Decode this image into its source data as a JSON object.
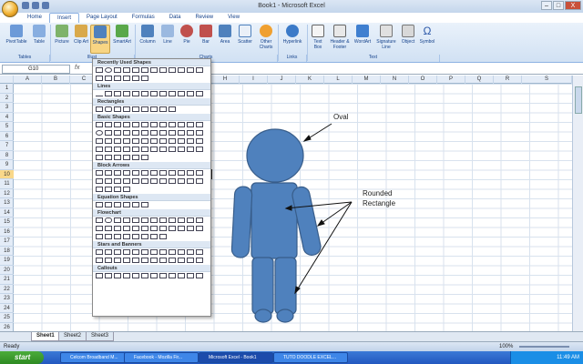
{
  "window": {
    "title": "Book1 - Microsoft Excel",
    "min": "–",
    "max": "□",
    "close": "X"
  },
  "tabs": [
    "Home",
    "Insert",
    "Page Layout",
    "Formulas",
    "Data",
    "Review",
    "View"
  ],
  "ribbon": {
    "buttons": [
      "PivotTable",
      "Table",
      "Picture",
      "Clip Art",
      "Shapes",
      "SmartArt",
      "Column",
      "Line",
      "Pie",
      "Bar",
      "Area",
      "Scatter",
      "Other Charts",
      "Hyperlink",
      "Text Box",
      "Header & Footer",
      "WordArt",
      "Signature Line",
      "Object",
      "Symbol"
    ],
    "groups": [
      "Tables",
      "Illust",
      "Charts",
      "Links",
      "Text"
    ]
  },
  "formula_bar": {
    "name_box": "G10",
    "fx": "fx",
    "value": ""
  },
  "columns": [
    "A",
    "B",
    "C",
    "D",
    "E",
    "F",
    "G",
    "H",
    "I",
    "J",
    "K",
    "L",
    "M",
    "N",
    "O",
    "P",
    "Q",
    "R",
    "S"
  ],
  "rows": [
    "1",
    "2",
    "3",
    "4",
    "5",
    "6",
    "7",
    "8",
    "9",
    "10",
    "11",
    "12",
    "13",
    "14",
    "15",
    "16",
    "17",
    "18",
    "19",
    "20",
    "21",
    "22",
    "23",
    "24",
    "25",
    "26"
  ],
  "shapes_menu": {
    "sections": [
      "Recently Used Shapes",
      "Lines",
      "Rectangles",
      "Basic Shapes",
      "Block Arrows",
      "Equation Shapes",
      "Flowchart",
      "Stars and Banners",
      "Callouts"
    ]
  },
  "annotations": {
    "oval": "Oval",
    "rounded1": "Rounded",
    "rounded2": "Rectangle"
  },
  "sheets": [
    "Sheet1",
    "Sheet2",
    "Sheet3"
  ],
  "status": {
    "ready": "Ready",
    "zoom": "100%"
  },
  "taskbar": {
    "start": "start",
    "items": [
      "Celcom Broadband M...",
      "Facebook - Mozilla Fir...",
      "Microsoft Excel - Book1",
      "TUTO DOODLE EXCEL..."
    ],
    "clock": "11:49 AM"
  },
  "colors": {
    "shape_fill": "#4f81bd",
    "shape_stroke": "#385d8a",
    "ribbon": "#d1e1f3"
  }
}
